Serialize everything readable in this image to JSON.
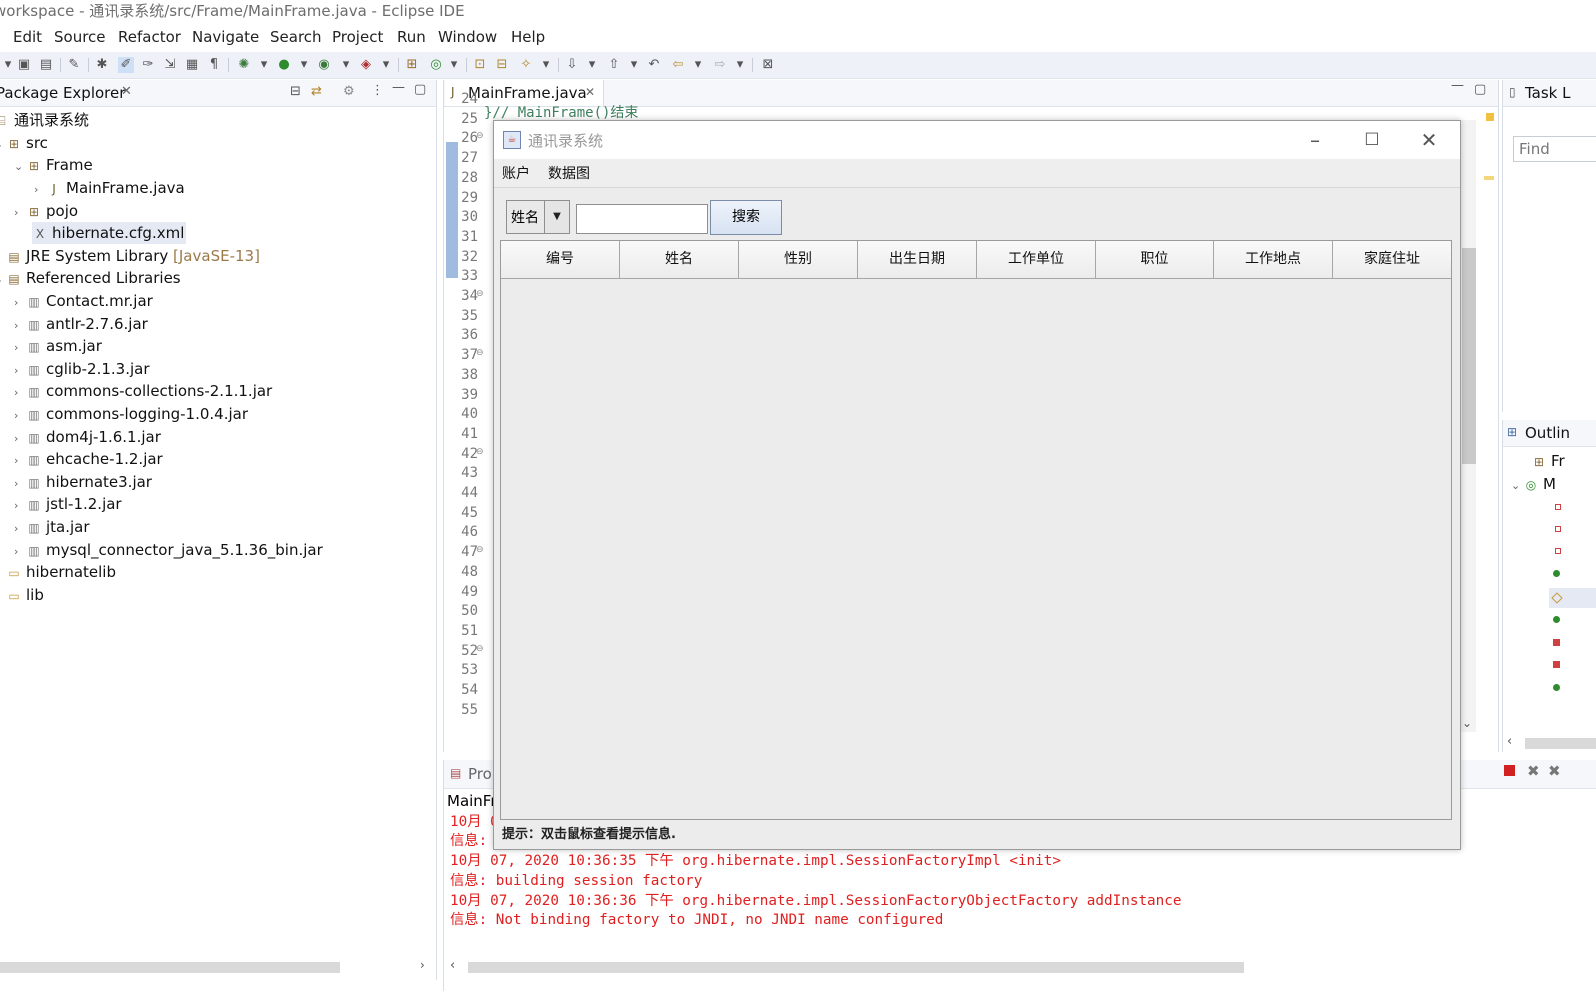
{
  "window": {
    "title": "workspace - 通讯录系统/src/Frame/MainFrame.java - Eclipse IDE"
  },
  "menu": [
    "Edit",
    "Source",
    "Refactor",
    "Navigate",
    "Search",
    "Project",
    "Run",
    "Window",
    "Help"
  ],
  "package_explorer": {
    "title": "Package Explorer",
    "project": "通讯录系统",
    "src": "src",
    "pkg_frame": "Frame",
    "mainframe": "MainFrame.java",
    "pkg_pojo": "pojo",
    "cfg": "hibernate.cfg.xml",
    "jre": "JRE System Library",
    "jre_ann": "[JavaSE-13]",
    "reflibs": "Referenced Libraries",
    "jars": [
      "Contact.mr.jar",
      "antlr-2.7.6.jar",
      "asm.jar",
      "cglib-2.1.3.jar",
      "commons-collections-2.1.1.jar",
      "commons-logging-1.0.4.jar",
      "dom4j-1.6.1.jar",
      "ehcache-1.2.jar",
      "hibernate3.jar",
      "jstl-1.2.jar",
      "jta.jar",
      "mysql_connector_java_5.1.36_bin.jar"
    ],
    "folders": [
      "hibernatelib",
      "lib"
    ]
  },
  "editor": {
    "tab": "MainFrame.java",
    "code_top": "}// MainFrame()结束",
    "line_numbers": [
      "24",
      "25",
      "26",
      "27",
      "28",
      "29",
      "30",
      "31",
      "32",
      "33",
      "34",
      "35",
      "36",
      "37",
      "38",
      "39",
      "40",
      "41",
      "42",
      "43",
      "44",
      "45",
      "46",
      "47",
      "48",
      "49",
      "50",
      "51",
      "52",
      "53",
      "54",
      "55"
    ]
  },
  "dialog": {
    "title": "通讯录系统",
    "menu": [
      "账户",
      "数据图"
    ],
    "combo_value": "姓名",
    "search_value": "",
    "search_button": "搜索",
    "columns": [
      "编号",
      "姓名",
      "性别",
      "出生日期",
      "工作单位",
      "职位",
      "工作地点",
      "家庭住址"
    ],
    "tip": "提示：双击鼠标查看提示信息."
  },
  "task_list": {
    "title": "Task L",
    "find_placeholder": "Find"
  },
  "outline": {
    "title": "Outlin",
    "item1": "Fr",
    "item2": "M"
  },
  "console": {
    "tab": "Prol",
    "label": "MainFr",
    "lines": [
      "10月 0",
      "信息:",
      "10月 07, 2020 10:36:35 下午 org.hibernate.impl.SessionFactoryImpl <init>",
      "信息: building session factory",
      "10月 07, 2020 10:36:36 下午 org.hibernate.impl.SessionFactoryObjectFactory addInstance",
      "信息: Not binding factory to JNDI, no JNDI name configured"
    ]
  }
}
